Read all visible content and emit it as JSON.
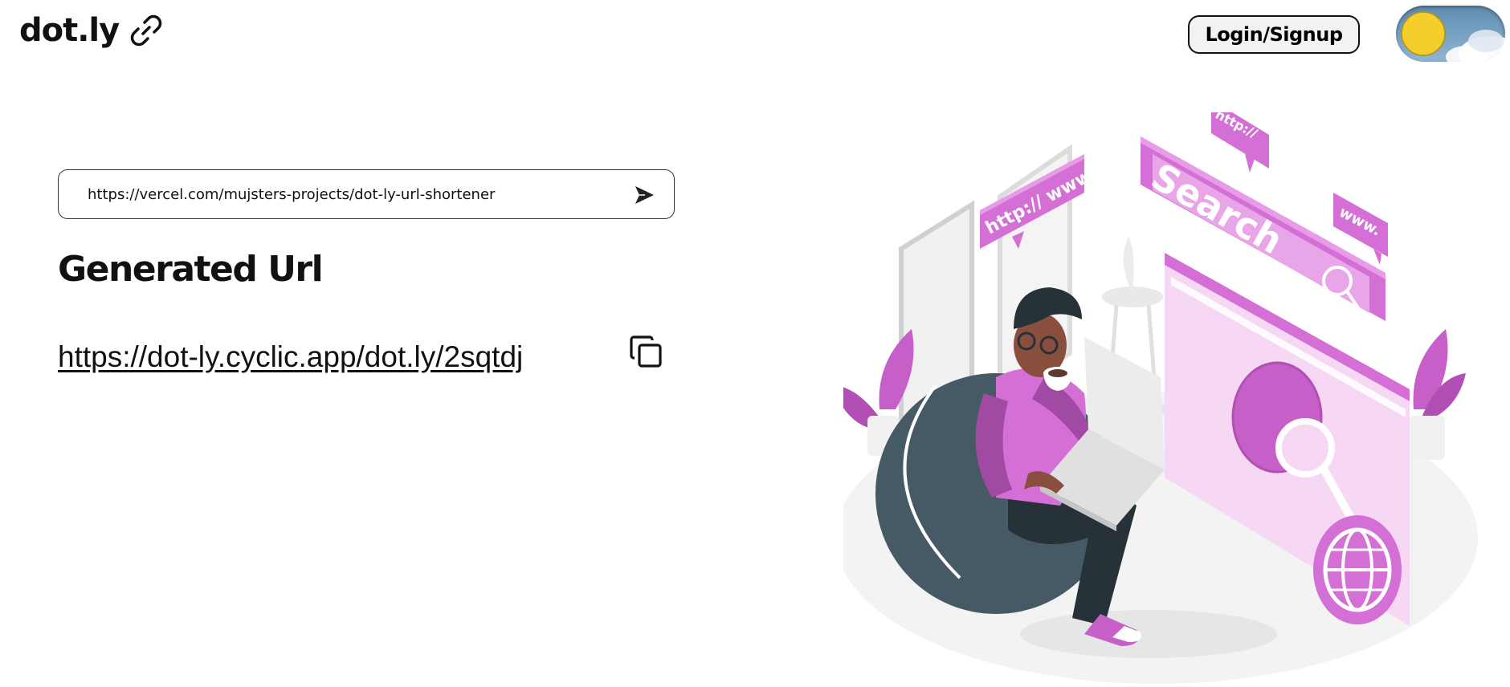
{
  "header": {
    "brand": "dot.ly",
    "brand_icon": "link-icon",
    "login_label": "Login/Signup",
    "theme_toggle_state": "light"
  },
  "form": {
    "url_value": "https://vercel.com/mujsters-projects/dot-ly-url-shortener",
    "send_icon": "send-icon"
  },
  "result": {
    "heading": "Generated Url",
    "short_url": "https://dot-ly.cyclic.app/dot.ly/2sqtdj",
    "copy_icon": "copy-icon"
  },
  "illustration": {
    "speech_bubble_left": "http:// www.",
    "speech_bubble_top": "http://",
    "speech_bubble_right": "www.",
    "search_panel": "Search"
  },
  "colors": {
    "accent_pink": "#d46fd6",
    "dark_pink": "#b24fb5",
    "light_pink": "#f0c6ef",
    "dark_slate": "#455a64"
  }
}
